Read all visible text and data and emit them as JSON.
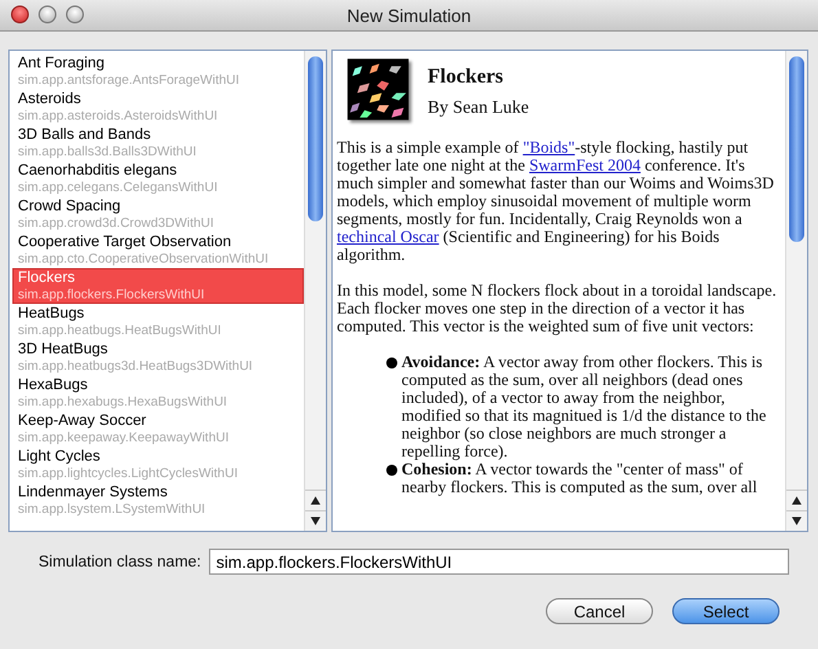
{
  "window": {
    "title": "New Simulation"
  },
  "simulations": [
    {
      "name": "Ant Foraging",
      "class_name": "sim.app.antsforage.AntsForageWithUI",
      "selected": false
    },
    {
      "name": "Asteroids",
      "class_name": "sim.app.asteroids.AsteroidsWithUI",
      "selected": false
    },
    {
      "name": "3D Balls and Bands",
      "class_name": "sim.app.balls3d.Balls3DWithUI",
      "selected": false
    },
    {
      "name": "Caenorhabditis elegans",
      "class_name": "sim.app.celegans.CelegansWithUI",
      "selected": false
    },
    {
      "name": "Crowd Spacing",
      "class_name": "sim.app.crowd3d.Crowd3DWithUI",
      "selected": false
    },
    {
      "name": "Cooperative Target Observation",
      "class_name": "sim.app.cto.CooperativeObservationWithUI",
      "selected": false
    },
    {
      "name": "Flockers",
      "class_name": "sim.app.flockers.FlockersWithUI",
      "selected": true
    },
    {
      "name": "HeatBugs",
      "class_name": "sim.app.heatbugs.HeatBugsWithUI",
      "selected": false
    },
    {
      "name": "3D HeatBugs",
      "class_name": "sim.app.heatbugs3d.HeatBugs3DWithUI",
      "selected": false
    },
    {
      "name": "HexaBugs",
      "class_name": "sim.app.hexabugs.HexaBugsWithUI",
      "selected": false
    },
    {
      "name": "Keep-Away Soccer",
      "class_name": "sim.app.keepaway.KeepawayWithUI",
      "selected": false
    },
    {
      "name": "Light Cycles",
      "class_name": "sim.app.lightcycles.LightCyclesWithUI",
      "selected": false
    },
    {
      "name": "Lindenmayer Systems",
      "class_name": "sim.app.lsystem.LSystemWithUI",
      "selected": false
    }
  ],
  "info": {
    "title": "Flockers",
    "author": "By Sean Luke",
    "paragraphs": [
      [
        {
          "text": "This is a simple example of "
        },
        {
          "link": "\"Boids\""
        },
        {
          "text": "-style flocking, hastily put together late one night at the "
        },
        {
          "link": "SwarmFest 2004"
        },
        {
          "text": " conference. It's much simpler and somewhat faster than our Woims and Woims3D models, which employ sinusoidal movement of multiple worm segments, mostly for fun. Incidentally, Craig Reynolds won a "
        },
        {
          "link": "techincal Oscar"
        },
        {
          "text": " (Scientific and Engineering) for his Boids algorithm."
        }
      ],
      [
        {
          "text": "In this model, some N flockers flock about in a toroidal landscape. Each flocker moves one step in the direction of a vector it has computed. This vector is the weighted sum of five unit vectors:"
        }
      ]
    ],
    "bullets": [
      "**Avoidance:** A vector away from other flockers. This is computed as the sum, over all neighbors (dead ones included), of a vector to away from the neighbor, modified so that its magnitued is 1/d the distance to the neighbor (so close neighbors are much stronger a repelling force).",
      "**Cohesion:** A vector towards the \"center of mass\" of nearby flockers. This is computed as the sum, over all"
    ]
  },
  "class_field": {
    "label": "Simulation class name:",
    "value": "sim.app.flockers.FlockersWithUI"
  },
  "buttons": [
    {
      "label": "Cancel",
      "default": false
    },
    {
      "label": "Select",
      "default": true
    }
  ]
}
